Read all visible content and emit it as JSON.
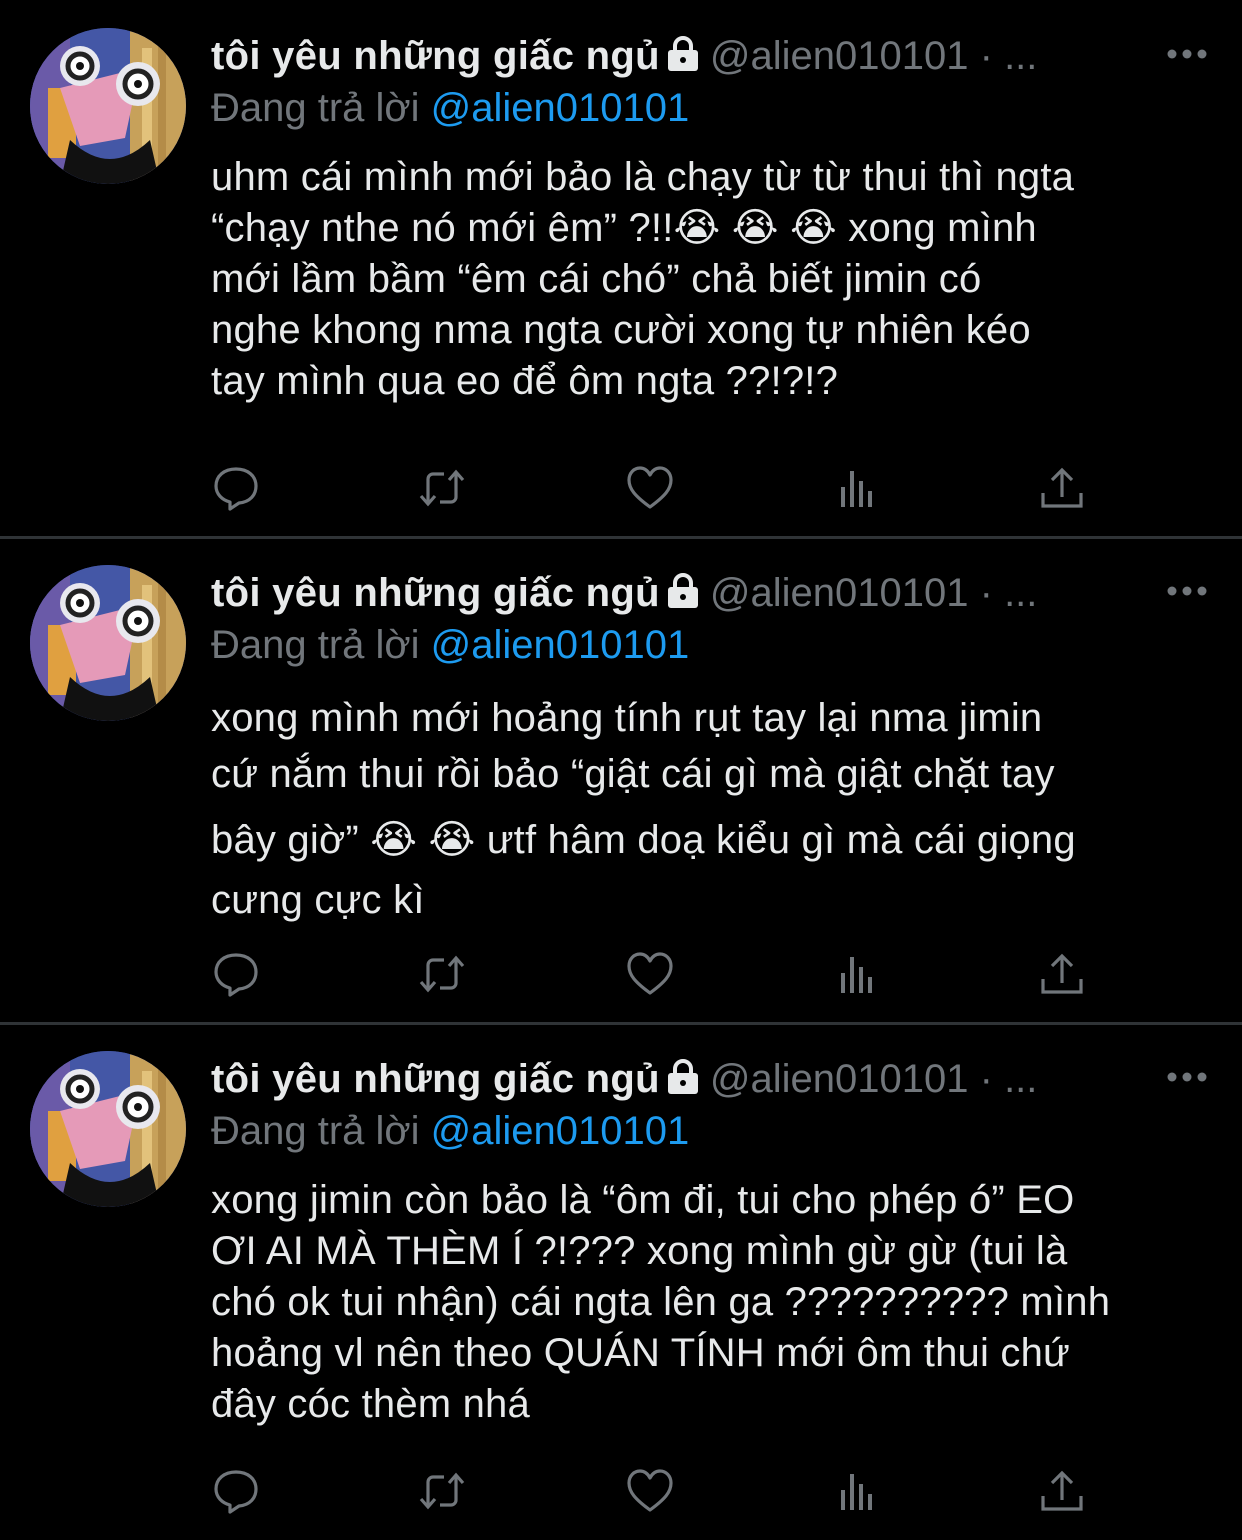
{
  "colors": {
    "background": "#000000",
    "divider": "#2f3336",
    "secondary_text": "#71767b",
    "link": "#1d9bf0",
    "primary_text": "#e7e9ea"
  },
  "tweets": [
    {
      "display_name": "tôi yêu những giấc ngủ",
      "handle": "@alien010101",
      "dot": "·",
      "ellipsis": "...",
      "reply_prefix": "Đang trả lời",
      "reply_handle": "@alien010101",
      "lines": [
        "uhm cái mình mới bảo là chạy từ từ thui thì ngta",
        "“chạy nthe nó mới êm” ?!!😭 😭 😭  xong mình",
        "mới lầm bầm “êm cái chó” chả biết jimin có",
        "nghe khong nma ngta cười xong tự nhiên kéo",
        "tay mình qua eo để ôm ngta ??!?!?"
      ],
      "actions": [
        "reply-icon",
        "retweet-icon",
        "like-icon",
        "analytics-icon",
        "share-icon"
      ]
    },
    {
      "display_name": "tôi yêu những giấc ngủ",
      "handle": "@alien010101",
      "dot": "·",
      "ellipsis": "...",
      "reply_prefix": "Đang trả lời",
      "reply_handle": "@alien010101",
      "lines": [
        "xong mình mới hoảng tính rụt tay lại nma jimin",
        "cứ nắm thui rồi bảo “giật cái gì mà giật chặt tay",
        "bây giờ” 😭 😭  ưtf hâm doạ kiểu gì mà cái giọng",
        "cưng cực kì"
      ],
      "actions": [
        "reply-icon",
        "retweet-icon",
        "like-icon",
        "analytics-icon",
        "share-icon"
      ]
    },
    {
      "display_name": "tôi yêu những giấc ngủ",
      "handle": "@alien010101",
      "dot": "·",
      "ellipsis": "...",
      "reply_prefix": "Đang trả lời",
      "reply_handle": "@alien010101",
      "lines": [
        "xong jimin còn bảo là “ôm đi, tui cho phép ó” EO",
        "ƠI AI MÀ THÈM Í ?!??? xong mình gừ gừ (tui là",
        "chó ok tui nhận) cái ngta lên ga ?????????? mình",
        "hoảng vl nên theo QUÁN TÍNH mới ôm thui chứ",
        "đây cóc thèm nhá"
      ],
      "actions": [
        "reply-icon",
        "retweet-icon",
        "like-icon",
        "analytics-icon",
        "share-icon"
      ]
    }
  ]
}
